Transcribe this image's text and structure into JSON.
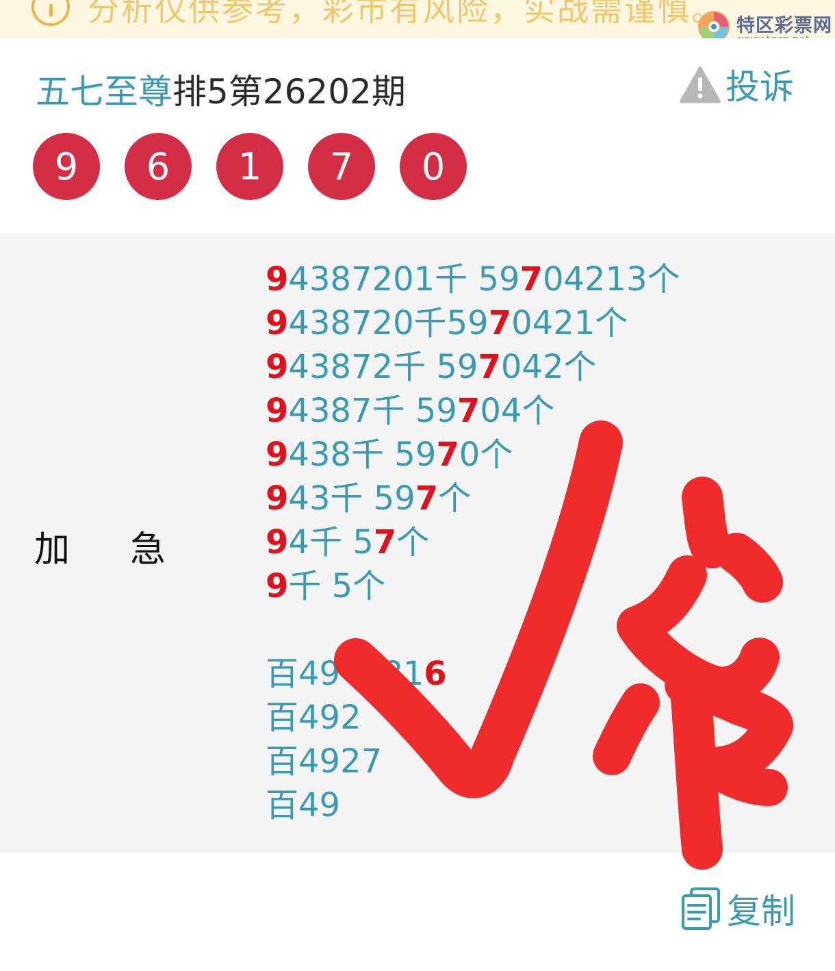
{
  "banner": {
    "notice": "分析仅供参考，彩市有风险，实战需谨慎。"
  },
  "watermark": {
    "name": "特区彩票网",
    "url": "www.tqcp.net"
  },
  "header": {
    "expert": "五七至尊",
    "issue": "排5第26202期",
    "complain_label": "投诉"
  },
  "draw_numbers": [
    "9",
    "6",
    "1",
    "7",
    "0"
  ],
  "content": {
    "label_1": "加",
    "label_2": "急",
    "lines": [
      [
        {
          "t": "9",
          "hit": true
        },
        {
          "t": "4387201千 59"
        },
        {
          "t": "7",
          "hit": true
        },
        {
          "t": "04213个"
        }
      ],
      [
        {
          "t": "9",
          "hit": true
        },
        {
          "t": "438720千59"
        },
        {
          "t": "7",
          "hit": true
        },
        {
          "t": "0421个"
        }
      ],
      [
        {
          "t": "9",
          "hit": true
        },
        {
          "t": "43872千 59"
        },
        {
          "t": "7",
          "hit": true
        },
        {
          "t": "042个"
        }
      ],
      [
        {
          "t": "9",
          "hit": true
        },
        {
          "t": "4387千 59"
        },
        {
          "t": "7",
          "hit": true
        },
        {
          "t": "04个"
        }
      ],
      [
        {
          "t": "9",
          "hit": true
        },
        {
          "t": "438千 59"
        },
        {
          "t": "7",
          "hit": true
        },
        {
          "t": "0个"
        }
      ],
      [
        {
          "t": "9",
          "hit": true
        },
        {
          "t": "43千 59"
        },
        {
          "t": "7",
          "hit": true
        },
        {
          "t": "个"
        }
      ],
      [
        {
          "t": "9",
          "hit": true
        },
        {
          "t": "4千 5"
        },
        {
          "t": "7",
          "hit": true
        },
        {
          "t": "个"
        }
      ],
      [
        {
          "t": "9",
          "hit": true
        },
        {
          "t": "千 5个"
        }
      ],
      [],
      [
        {
          "t": "百49"
        },
        {
          "t": "  "
        },
        {
          "t": "381"
        },
        {
          "t": "6",
          "hit": true
        }
      ],
      [
        {
          "t": "百492"
        },
        {
          "t": "   "
        },
        {
          "t": "3"
        }
      ],
      [
        {
          "t": "百4927"
        }
      ],
      [
        {
          "t": "百49"
        }
      ]
    ]
  },
  "copy_label": "复制",
  "colors": {
    "accent": "#3a9ab0",
    "ball": "#d42e46",
    "hit": "#e0101c",
    "mark": "#f02b2b"
  }
}
